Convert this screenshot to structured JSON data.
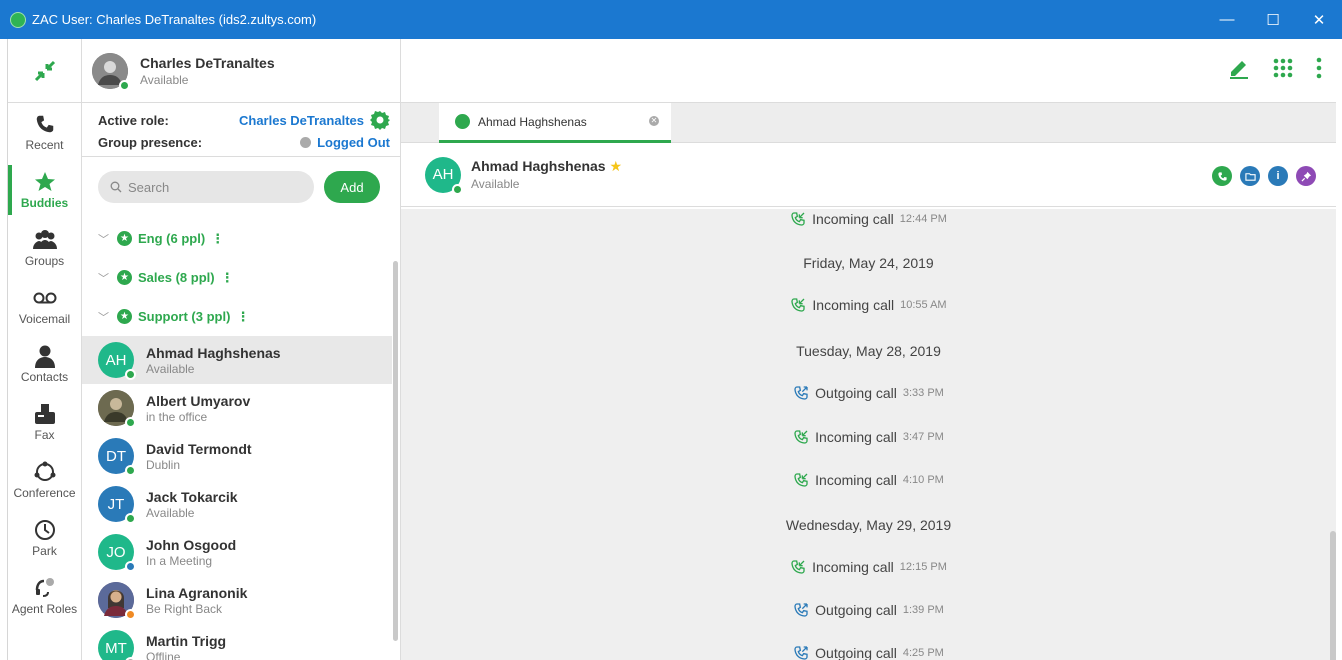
{
  "window": {
    "title": "ZAC User: Charles DeTranaltes (ids2.zultys.com)",
    "minimize_label": "—",
    "maximize_label": "☐",
    "close_label": "✕"
  },
  "nav": {
    "items": [
      {
        "label": "Recent",
        "icon": "phone-icon"
      },
      {
        "label": "Buddies",
        "icon": "star-icon"
      },
      {
        "label": "Groups",
        "icon": "people-icon"
      },
      {
        "label": "Voicemail",
        "icon": "voicemail-icon"
      },
      {
        "label": "Contacts",
        "icon": "person-icon"
      },
      {
        "label": "Fax",
        "icon": "fax-icon"
      },
      {
        "label": "Conference",
        "icon": "conference-icon"
      },
      {
        "label": "Park",
        "icon": "clock-icon"
      },
      {
        "label": "Agent Roles",
        "icon": "headset-icon"
      }
    ]
  },
  "user": {
    "name": "Charles DeTranaltes",
    "status": "Available"
  },
  "role": {
    "active_role_label": "Active role:",
    "active_role_value": "Charles DeTranaltes",
    "group_presence_label": "Group presence:",
    "group_presence_value": "Logged Out"
  },
  "search": {
    "placeholder": "Search",
    "add_label": "Add"
  },
  "groups": [
    {
      "label": "Eng (6 ppl)"
    },
    {
      "label": "Sales (8 ppl)"
    },
    {
      "label": "Support (3 ppl)"
    }
  ],
  "buddies": [
    {
      "initials": "AH",
      "name": "Ahmad Haghshenas",
      "status": "Available",
      "color": "#1fb88a",
      "presence": "#2ea84e"
    },
    {
      "initials": "",
      "name": "Albert Umyarov",
      "status": "in the office",
      "color": "#5a5a4a",
      "presence": "#2ea84e"
    },
    {
      "initials": "DT",
      "name": "David Termondt",
      "status": "Dublin",
      "color": "#2a7ab8",
      "presence": "#2ea84e"
    },
    {
      "initials": "JT",
      "name": "Jack Tokarcik",
      "status": "Available",
      "color": "#2a7ab8",
      "presence": "#2ea84e"
    },
    {
      "initials": "JO",
      "name": "John Osgood",
      "status": "In a Meeting",
      "color": "#1fb88a",
      "presence": "#2a7ab8"
    },
    {
      "initials": "",
      "name": "Lina Agranonik",
      "status": "Be Right Back",
      "color": "#5a4a6a",
      "presence": "#f08a24"
    },
    {
      "initials": "MT",
      "name": "Martin Trigg",
      "status": "Offline",
      "color": "#1fb88a",
      "presence": "#aaaaaa"
    }
  ],
  "tab": {
    "label": "Ahmad Haghshenas"
  },
  "contact": {
    "initials": "AH",
    "name": "Ahmad Haghshenas",
    "status": "Available"
  },
  "history": [
    {
      "kind": "call",
      "label": "Incoming call",
      "time": "12:44 PM",
      "direction": "incoming"
    },
    {
      "kind": "date",
      "label": "Friday, May 24, 2019"
    },
    {
      "kind": "call",
      "label": "Incoming call",
      "time": "10:55 AM",
      "direction": "incoming"
    },
    {
      "kind": "date",
      "label": "Tuesday, May 28, 2019"
    },
    {
      "kind": "call",
      "label": "Outgoing call",
      "time": "3:33 PM",
      "direction": "outgoing"
    },
    {
      "kind": "call",
      "label": "Incoming call",
      "time": "3:47 PM",
      "direction": "incoming"
    },
    {
      "kind": "call",
      "label": "Incoming call",
      "time": "4:10 PM",
      "direction": "incoming"
    },
    {
      "kind": "date",
      "label": "Wednesday, May 29, 2019"
    },
    {
      "kind": "call",
      "label": "Incoming call",
      "time": "12:15 PM",
      "direction": "incoming"
    },
    {
      "kind": "call",
      "label": "Outgoing call",
      "time": "1:39 PM",
      "direction": "outgoing"
    },
    {
      "kind": "call",
      "label": "Outgoing call",
      "time": "4:25 PM",
      "direction": "outgoing"
    }
  ],
  "colors": {
    "accent": "#2ea84e",
    "titlebar": "#1b78d0",
    "incoming": "#2ea84e",
    "outgoing": "#2a7ab8"
  }
}
